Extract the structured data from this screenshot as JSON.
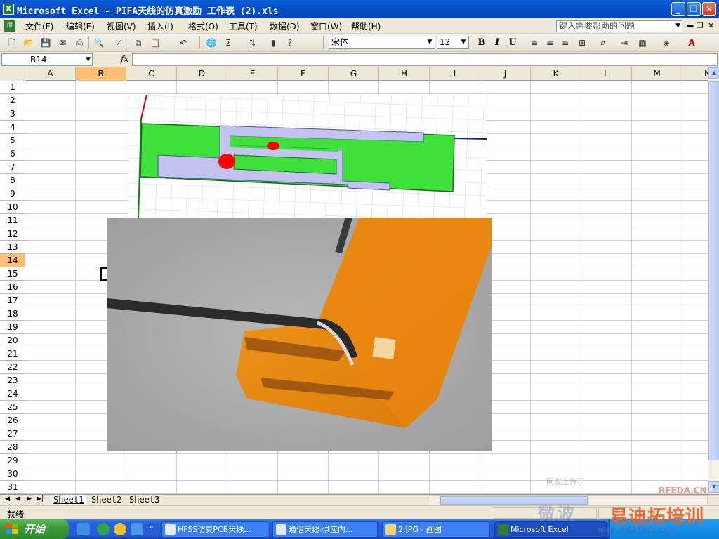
{
  "window": {
    "title": "Microsoft Excel - PIFA天线的仿真激励 工作表 (2).xls",
    "app_icon": "excel-icon",
    "controls": {
      "minimize": "_",
      "restore": "❐",
      "close": "✕"
    }
  },
  "menubar": {
    "items": [
      "文件(F)",
      "编辑(E)",
      "视图(V)",
      "插入(I)",
      "格式(O)",
      "工具(T)",
      "数据(D)",
      "窗口(W)",
      "帮助(H)"
    ],
    "help_placeholder": "键入需要帮助的问题"
  },
  "toolbar": {
    "font_name": "宋体",
    "font_size": "12",
    "bold": "B",
    "italic": "I",
    "underline": "U",
    "sigma": "Σ",
    "font_color_letter": "A"
  },
  "formula_bar": {
    "name_box": "B14",
    "fx": "fx",
    "formula": ""
  },
  "grid": {
    "columns": [
      "A",
      "B",
      "C",
      "D",
      "E",
      "F",
      "G",
      "H",
      "I",
      "J",
      "K",
      "L",
      "M",
      "N"
    ],
    "rows": [
      "1",
      "2",
      "3",
      "4",
      "5",
      "6",
      "7",
      "8",
      "9",
      "10",
      "11",
      "12",
      "13",
      "14",
      "15",
      "16",
      "17",
      "18",
      "19",
      "20",
      "21",
      "22",
      "23",
      "24",
      "25",
      "26",
      "27",
      "28",
      "29",
      "30",
      "31"
    ],
    "active_column": "B",
    "active_row": "14"
  },
  "sheets": {
    "tabs": [
      "Sheet1",
      "Sheet2",
      "Sheet3"
    ],
    "active": "Sheet1"
  },
  "status": {
    "text": "就绪"
  },
  "taskbar": {
    "start_label": "开始",
    "tasks": [
      {
        "label": "HFSS仿真PCB天线...",
        "icon_color": "#e8e8ff"
      },
      {
        "label": "通信天线-供应内...",
        "icon_color": "#e8e8ff"
      },
      {
        "label": "2.JPG - 画图",
        "icon_color": "#f5d36b"
      },
      {
        "label": "Microsoft Excel",
        "icon_color": "#2e7d32"
      }
    ]
  },
  "watermark": {
    "line1": "网友上传于",
    "line2": "RFEDA.CN",
    "line3": "微波",
    "line4": "易迪拓培训",
    "line5": "www.edatop.com"
  },
  "colors": {
    "title_bar": "#0550c8",
    "active_header": "#ffc073",
    "pcb_green": "#3ee03a",
    "pcb_slot": "#c3c3f0",
    "feed_red": "#ff0000",
    "fpc_orange": "#e88a10"
  }
}
